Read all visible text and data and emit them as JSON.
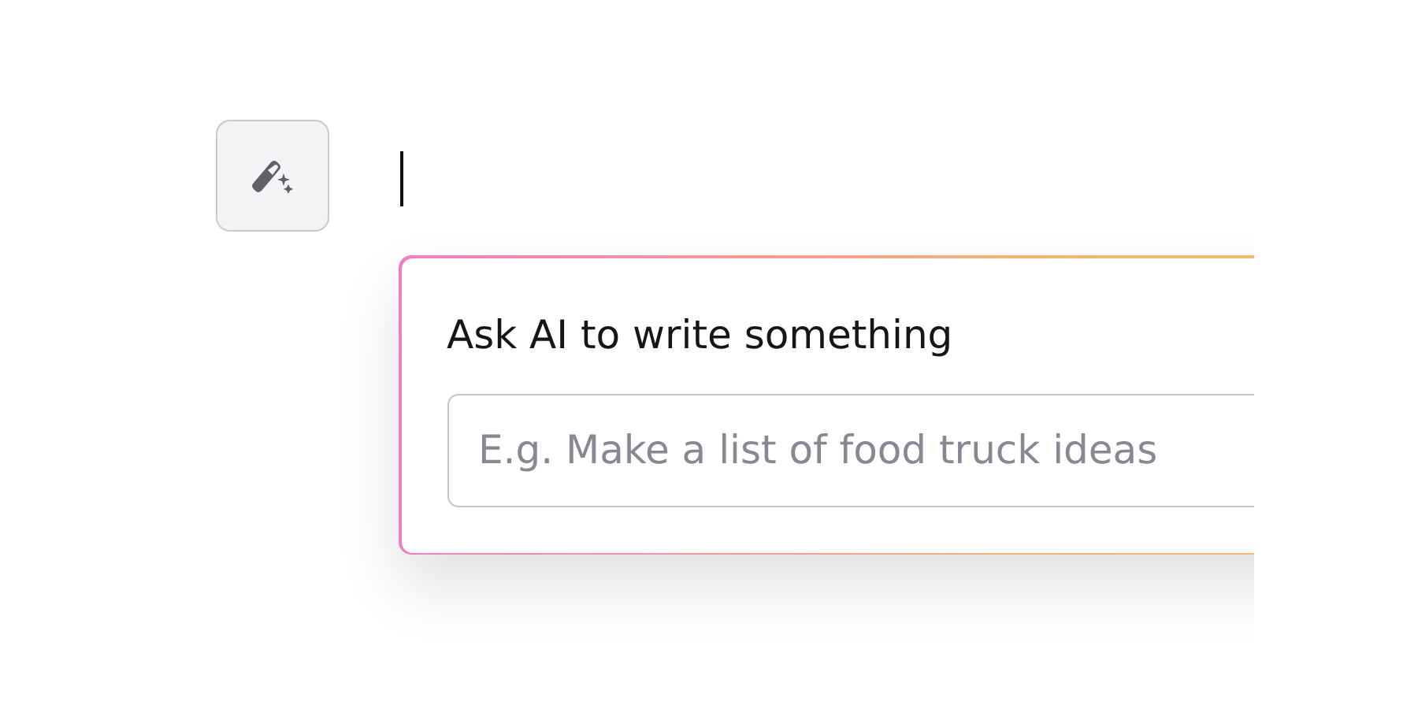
{
  "editor": {
    "ai_button": {
      "kind": "magic"
    },
    "cursor": true
  },
  "ai_prompt": {
    "label": "Ask AI to write something",
    "input": {
      "placeholder": "E.g. Make a list of food truck ideas"
    }
  }
}
